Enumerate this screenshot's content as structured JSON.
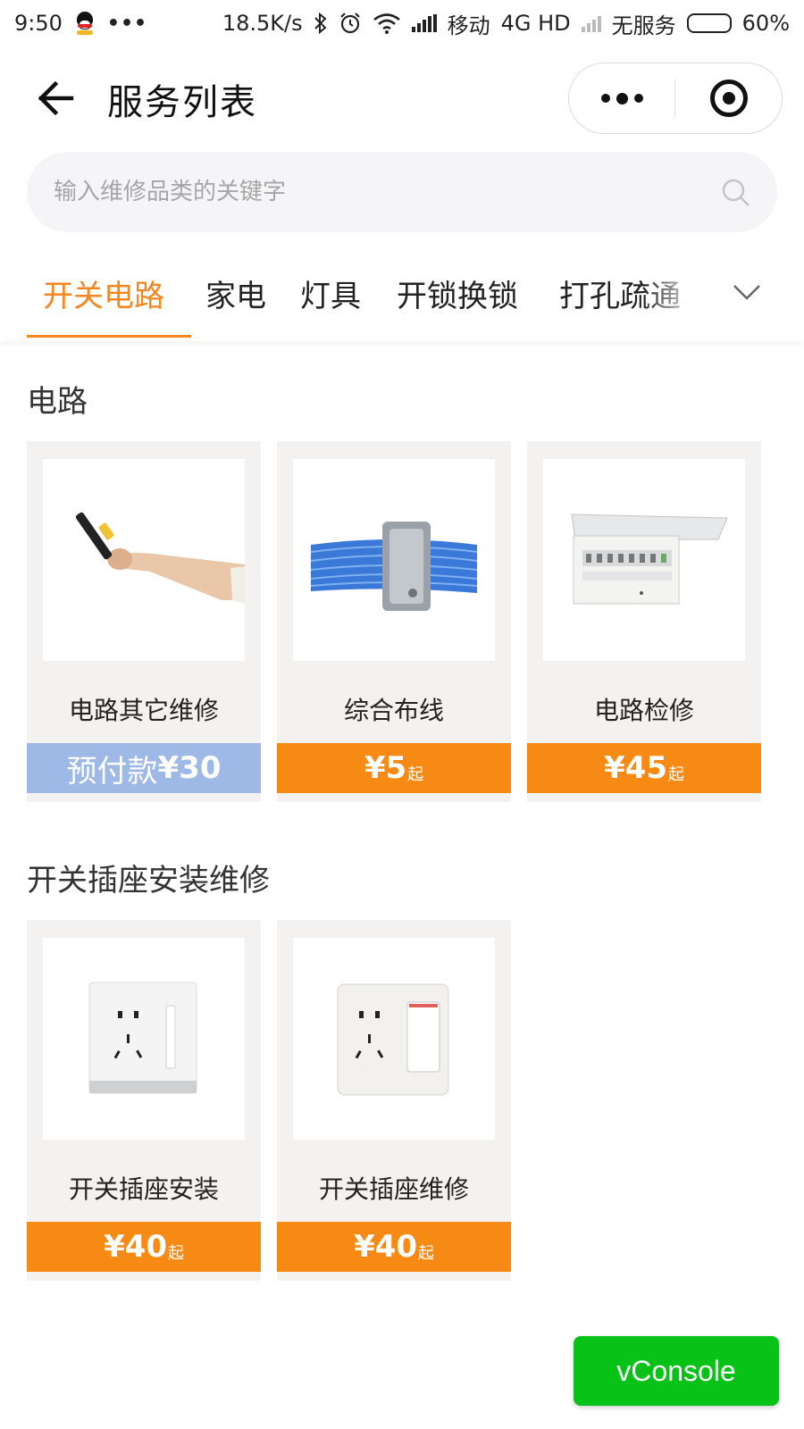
{
  "status_bar": {
    "time": "9:50",
    "more": "•••",
    "speed": "18.5K/s",
    "carrier": "移动",
    "network": "4G HD",
    "no_service": "无服务",
    "battery_text": "60%",
    "battery_level": 0.6
  },
  "nav": {
    "title": "服务列表"
  },
  "search": {
    "placeholder": "输入维修品类的关键字",
    "value": ""
  },
  "tabs": [
    {
      "label": "开关电路",
      "active": true
    },
    {
      "label": "家电",
      "active": false
    },
    {
      "label": "灯具",
      "active": false
    },
    {
      "label": "开锁换锁",
      "active": false
    },
    {
      "label": "打孔疏通",
      "active": false
    }
  ],
  "sections": [
    {
      "title": "电路",
      "items": [
        {
          "name": "电路其它维修",
          "price_prefix": "预付款",
          "price": "¥30",
          "price_suffix": "",
          "image": "electrician-tester-hand"
        },
        {
          "name": "综合布线",
          "price_prefix": "",
          "price": "¥5",
          "price_suffix": "起",
          "image": "blue-cable-bundle"
        },
        {
          "name": "电路检修",
          "price_prefix": "",
          "price": "¥45",
          "price_suffix": "起",
          "image": "distribution-box"
        }
      ]
    },
    {
      "title": "开关插座安装维修",
      "items": [
        {
          "name": "开关插座安装",
          "price_prefix": "",
          "price": "¥40",
          "price_suffix": "起",
          "image": "wall-socket-switch"
        },
        {
          "name": "开关插座维修",
          "price_prefix": "",
          "price": "¥40",
          "price_suffix": "起",
          "image": "wall-socket-switch"
        }
      ]
    }
  ],
  "vconsole": {
    "label": "vConsole"
  },
  "colors": {
    "accent": "#f5861f",
    "price_bar": "#f78a15",
    "prepay_bar": "#9eb9e6",
    "vconsole": "#08c218"
  }
}
